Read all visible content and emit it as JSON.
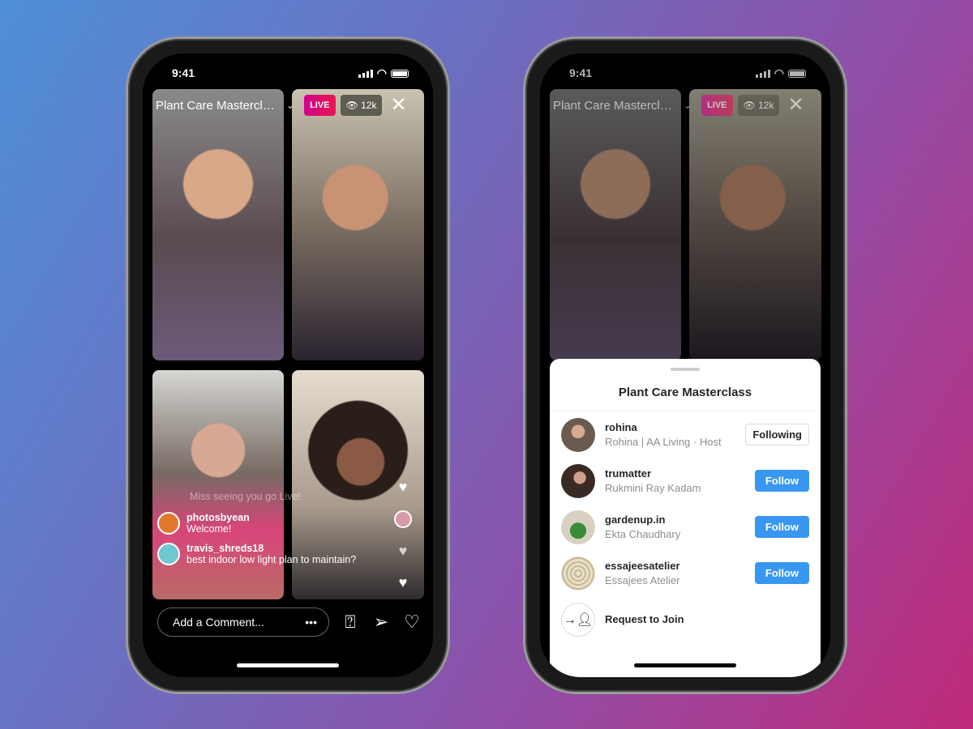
{
  "status": {
    "time": "9:41"
  },
  "live": {
    "title": "Plant Care Masterclass",
    "live_badge": "LIVE",
    "viewers": "12k"
  },
  "comments": [
    {
      "text": "Miss seeing you go Live!"
    },
    {
      "user": "photosbyean",
      "text": "Welcome!"
    },
    {
      "user": "travis_shreds18",
      "text": "best indoor low light plan to maintain?"
    }
  ],
  "comment_input": {
    "placeholder": "Add a Comment...",
    "more": "•••"
  },
  "sheet": {
    "title": "Plant Care Masterclass",
    "participants": [
      {
        "username": "rohina",
        "subtitle": "Rohina | AA Living · Host",
        "button": "Following"
      },
      {
        "username": "trumatter",
        "subtitle": "Rukmini Ray Kadam",
        "button": "Follow"
      },
      {
        "username": "gardenup.in",
        "subtitle": "Ekta Chaudhary",
        "button": "Follow"
      },
      {
        "username": "essajeesatelier",
        "subtitle": "Essajees Atelier",
        "button": "Follow"
      }
    ],
    "request_label": "Request to Join"
  },
  "colors": {
    "follow": "#3897f0",
    "live_badge": "#e0006b"
  }
}
